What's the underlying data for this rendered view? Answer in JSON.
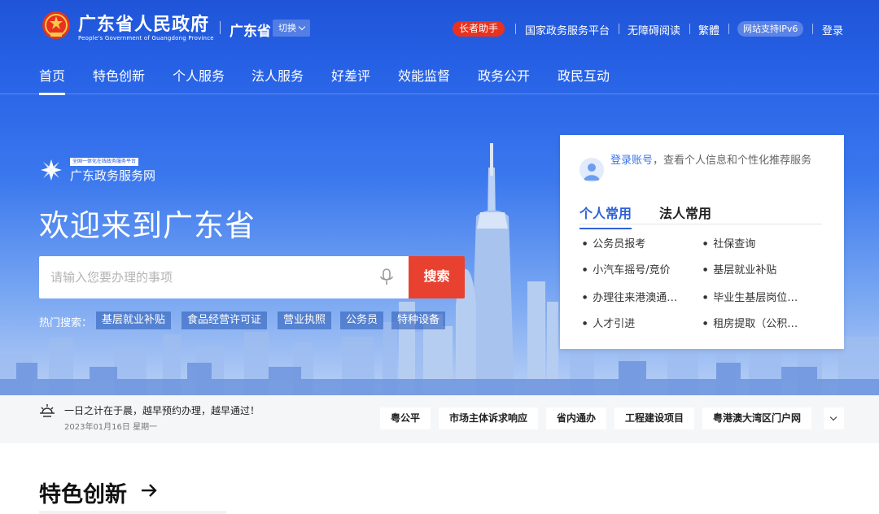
{
  "header": {
    "title_cn": "广东省人民政府",
    "title_en": "People's Government of Guangdong Province",
    "province": "广东省",
    "switch_label": "切换",
    "elder_label": "长者助手",
    "links": [
      "国家政务服务平台",
      "无障碍阅读",
      "繁體"
    ],
    "ipv6_label": "网站支持IPv6",
    "login_label": "登录"
  },
  "nav": {
    "items": [
      "首页",
      "特色创新",
      "个人服务",
      "法人服务",
      "好差评",
      "效能监督",
      "政务公开",
      "政民互动"
    ],
    "active_index": 0
  },
  "brand": {
    "badge": "全国一体化在线政务服务平台",
    "name": "广东政务服务网"
  },
  "welcome": "欢迎来到广东省",
  "search": {
    "placeholder": "请输入您要办理的事项",
    "button": "搜索",
    "hot_label": "热门搜索：",
    "hot_tags": [
      "基层就业补贴",
      "食品经营许可证",
      "营业执照",
      "公务员",
      "特种设备"
    ]
  },
  "card": {
    "login_link": "登录账号",
    "login_desc": "，查看个人信息和个性化推荐服务",
    "tabs": [
      "个人常用",
      "法人常用"
    ],
    "active_tab": 0,
    "items_left": [
      "公务员报考",
      "小汽车摇号/竞价",
      "办理往来港澳通…",
      "人才引进"
    ],
    "items_right": [
      "社保查询",
      "基层就业补贴",
      "毕业生基层岗位…",
      "租房提取（公积…"
    ]
  },
  "strip": {
    "slogan": "一日之计在于晨，越早预约办理，越早通过！",
    "date": "2023年01月16日 星期一",
    "quick_links": [
      "粤公平",
      "市场主体诉求响应",
      "省内通办",
      "工程建设项目",
      "粤港澳大湾区门户网"
    ]
  },
  "section": {
    "title": "特色创新"
  },
  "colors": {
    "primary_blue": "#2762e6",
    "accent_red": "#e8412f",
    "link_blue": "#3a73e8"
  }
}
